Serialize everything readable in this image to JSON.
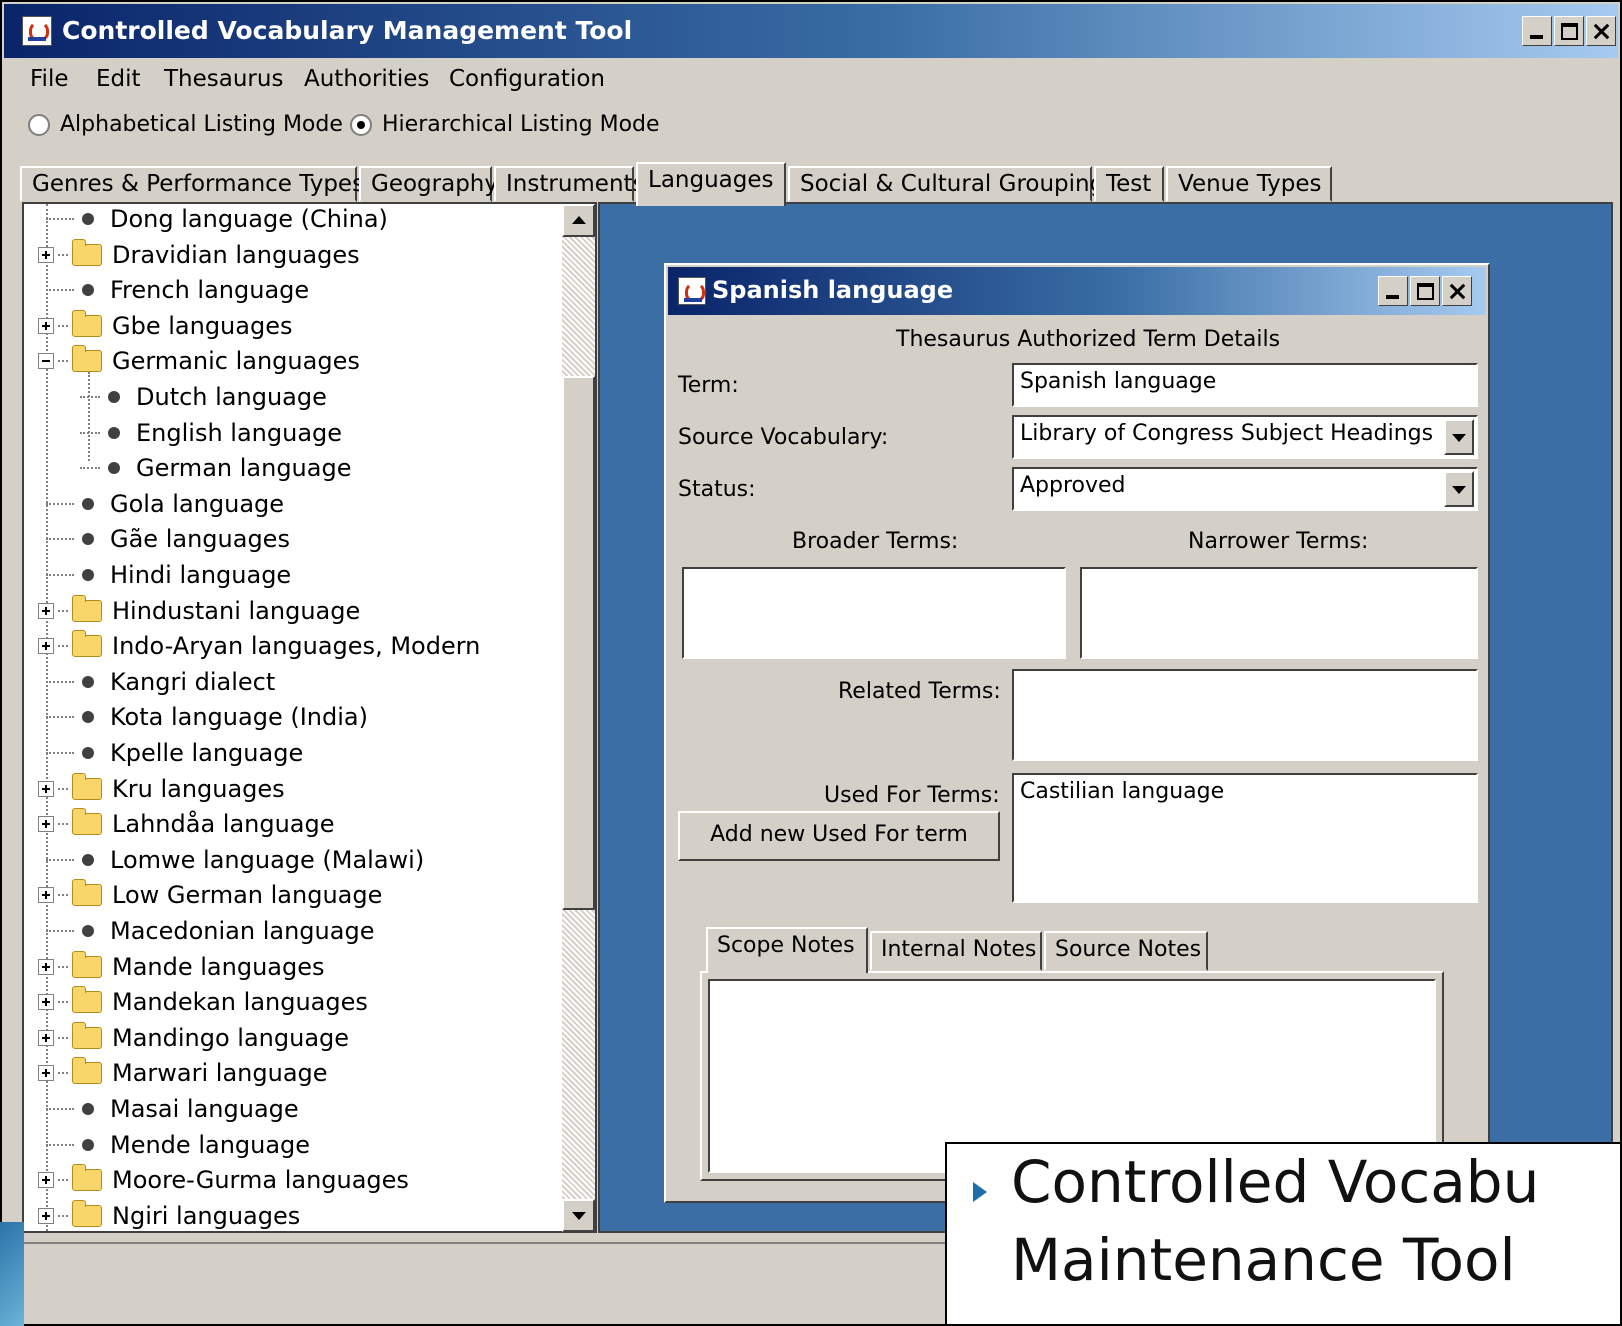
{
  "window": {
    "title": "Controlled Vocabulary Management Tool"
  },
  "menu": [
    "File",
    "Edit",
    "Thesaurus",
    "Authorities",
    "Configuration"
  ],
  "listing_modes": {
    "alphabetical": {
      "label": "Alphabetical Listing Mode",
      "selected": false
    },
    "hierarchical": {
      "label": "Hierarchical Listing Mode",
      "selected": true
    }
  },
  "tabs": [
    "Genres & Performance Types",
    "Geography",
    "Instruments",
    "Languages",
    "Social & Cultural Groupings",
    "Test",
    "Venue Types"
  ],
  "selected_tab": "Languages",
  "tree": {
    "items": [
      {
        "label": "Dong language (China)",
        "type": "leaf"
      },
      {
        "label": "Dravidian languages",
        "type": "folder"
      },
      {
        "label": "French language",
        "type": "leaf"
      },
      {
        "label": "Gbe languages",
        "type": "folder"
      },
      {
        "label": "Germanic languages",
        "type": "folder-open"
      },
      {
        "label": "Dutch language",
        "type": "leaf-child"
      },
      {
        "label": "English language",
        "type": "leaf-child"
      },
      {
        "label": "German language",
        "type": "leaf-child"
      },
      {
        "label": "Gola language",
        "type": "leaf"
      },
      {
        "label": "Gãe languages",
        "type": "leaf"
      },
      {
        "label": "Hindi language",
        "type": "leaf"
      },
      {
        "label": "Hindustani language",
        "type": "folder"
      },
      {
        "label": "Indo-Aryan languages, Modern",
        "type": "folder"
      },
      {
        "label": "Kangri dialect",
        "type": "leaf"
      },
      {
        "label": "Kota language (India)",
        "type": "leaf"
      },
      {
        "label": "Kpelle language",
        "type": "leaf"
      },
      {
        "label": "Kru languages",
        "type": "folder"
      },
      {
        "label": "Lahndåa language",
        "type": "folder"
      },
      {
        "label": "Lomwe language (Malawi)",
        "type": "leaf"
      },
      {
        "label": "Low German language",
        "type": "folder"
      },
      {
        "label": "Macedonian language",
        "type": "leaf"
      },
      {
        "label": "Mande languages",
        "type": "folder"
      },
      {
        "label": "Mandekan languages",
        "type": "folder"
      },
      {
        "label": "Mandingo language",
        "type": "folder"
      },
      {
        "label": "Marwari language",
        "type": "folder"
      },
      {
        "label": "Masai language",
        "type": "leaf"
      },
      {
        "label": "Mende language",
        "type": "leaf"
      },
      {
        "label": "Moore-Gurma languages",
        "type": "folder"
      },
      {
        "label": "Ngiri languages",
        "type": "folder"
      }
    ]
  },
  "detail": {
    "window_title": "Spanish language",
    "heading": "Thesaurus Authorized Term Details",
    "term_label": "Term:",
    "term_value": "Spanish language",
    "source_label": "Source Vocabulary:",
    "source_value": "Library of Congress Subject Headings",
    "status_label": "Status:",
    "status_value": "Approved",
    "broader_label": "Broader Terms:",
    "narrower_label": "Narrower Terms:",
    "related_label": "Related Terms:",
    "used_for_label": "Used For Terms:",
    "used_for_values": [
      "Castilian language"
    ],
    "add_used_for_button": "Add new Used For term",
    "note_tabs": [
      "Scope Notes",
      "Internal Notes",
      "Source Notes"
    ],
    "selected_note_tab": "Scope Notes"
  },
  "caption": {
    "line1": "Controlled Vocabu",
    "line2": "Maintenance Tool"
  },
  "colors": {
    "titlebar_start": "#0a246a",
    "titlebar_end": "#a6caf0",
    "desktop": "#3a6ea5",
    "chrome": "#d4d0c8",
    "bullet": "#1f6ea8"
  }
}
